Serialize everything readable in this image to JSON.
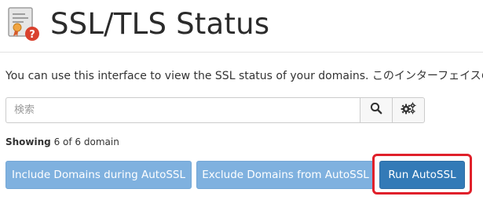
{
  "header": {
    "title": "SSL/TLS Status",
    "icon": "ssl-certificate-warning-icon"
  },
  "description": "You can use this interface to view the SSL status of your domains. このインターフェイスの詳細",
  "search": {
    "placeholder": "検索",
    "search_icon": "search-icon",
    "settings_icon": "gears-icon"
  },
  "showing": {
    "label": "Showing",
    "text": "6 of 6 domain"
  },
  "buttons": {
    "include": "Include Domains during AutoSSL",
    "exclude": "Exclude Domains from AutoSSL",
    "run": "Run AutoSSL"
  },
  "colors": {
    "primary": "#337ab7",
    "primary_disabled": "#7fb1df",
    "highlight": "#e0202a",
    "warning_badge": "#d9412e"
  }
}
